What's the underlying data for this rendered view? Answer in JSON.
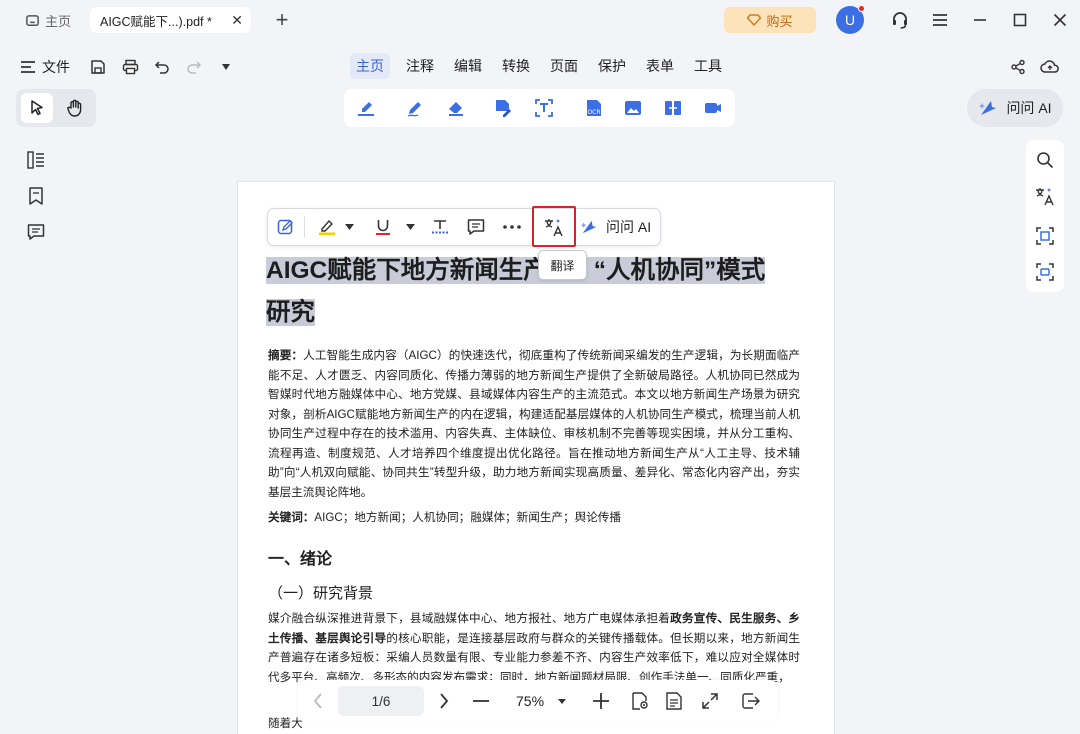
{
  "tabs": {
    "home": "主页",
    "doc": "AIGC赋能下...).pdf *",
    "close": "✕",
    "new": "+"
  },
  "topright": {
    "buy": "购买",
    "avatar": "U"
  },
  "menubar": {
    "file": "文件",
    "tabs": [
      "主页",
      "注释",
      "编辑",
      "转换",
      "页面",
      "保护",
      "表单",
      "工具"
    ],
    "active_tab": "主页"
  },
  "ask_ai": "问问 AI",
  "float_toolbar": {
    "ask_ai": "问问 AI",
    "tooltip": "翻译"
  },
  "document": {
    "title": "AIGC赋能下地方新闻生产“人机协同”模式研究",
    "title_line1_before": "AIGC赋能下地方新闻生产",
    "title_line1_after": "“人机协同”模式",
    "title_line2": "研究",
    "abstract_label": "摘要：",
    "abstract": "人工智能生成内容（AIGC）的快速迭代，彻底重构了传统新闻采编发的生产逻辑，为长期面临产能不足、人才匮乏、内容同质化、传播力薄弱的地方新闻生产提供了全新破局路径。人机协同已然成为智媒时代地方融媒体中心、地方党媒、县域媒体内容生产的主流范式。本文以地方新闻生产场景为研究对象，剖析AIGC赋能地方新闻生产的内在逻辑，构建适配基层媒体的人机协同生产模式，梳理当前人机协同生产过程中存在的技术滥用、内容失真、主体缺位、审核机制不完善等现实困境，并从分工重构、流程再造、制度规范、人才培养四个维度提出优化路径。旨在推动地方新闻生产从“人工主导、技术辅助”向“人机双向赋能、协同共生”转型升级，助力地方新闻实现高质量、差异化、常态化内容产出，夯实基层主流舆论阵地。",
    "keywords_label": "关键词：",
    "keywords": "AIGC；地方新闻；人机协同；融媒体；新闻生产；舆论传播",
    "h1": "一、绪论",
    "h2": "（一）研究背景",
    "bg_p1": "媒介融合纵深推进背景下，县域融媒体中心、地方报社、地方广电媒体承担着",
    "bg_bold1": "政务宣传、民生服务、乡土传播、基层舆论引导",
    "bg_p2": "的核心职能，是连接基层政府与群众的关键传播载体。但长期以来，地方新闻生产普遍存在诸多短板：采编人员数量有限、专业能力参差不齐、内容生产效率低下，难以应对全媒体时代多平台、高频次、多形态的内容发布需求；同时，地方新闻题材局限、创作手法单一、同质化严重，",
    "bg_p3": "随着大"
  },
  "pager": {
    "page": "1/6",
    "zoom": "75%"
  },
  "colors": {
    "accent": "#3b63d8",
    "highlight": "#c9ccd8",
    "buy_bg": "#fde3b9",
    "red_box": "#d4242a"
  }
}
